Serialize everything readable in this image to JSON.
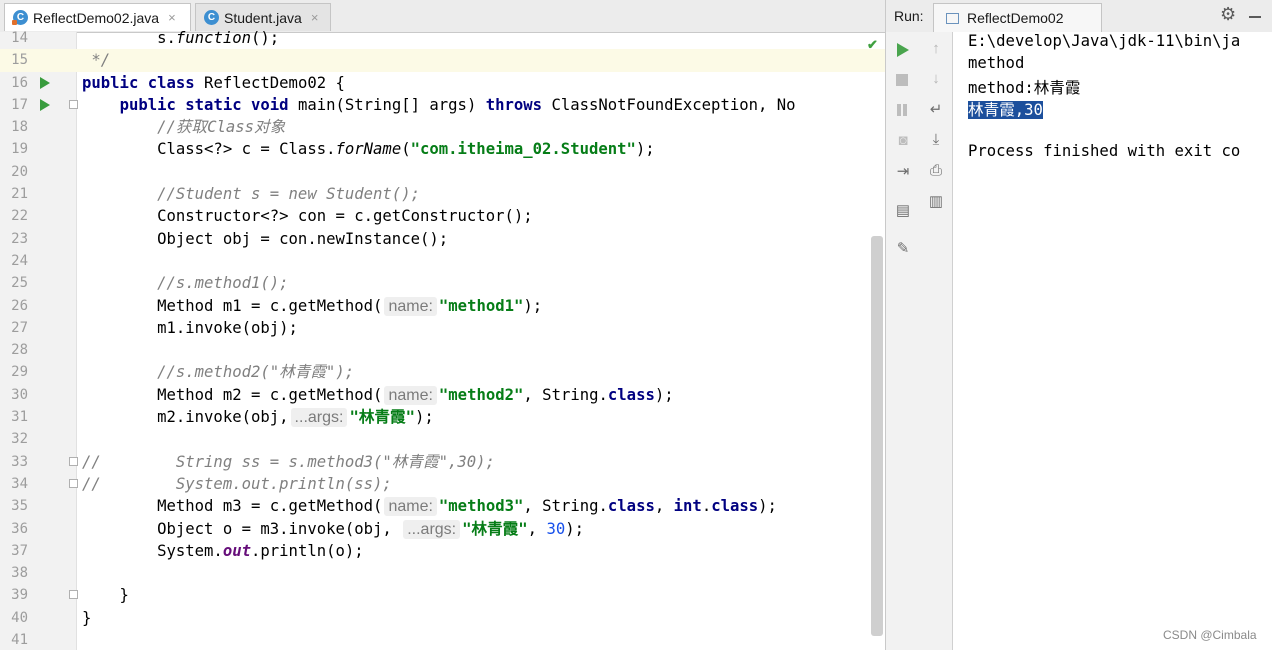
{
  "editor": {
    "tabs": [
      {
        "label": "ReflectDemo02.java",
        "close": "×"
      },
      {
        "label": "Student.java",
        "close": "×"
      }
    ],
    "file_icon_letter": "C",
    "lines": [
      {
        "n": "14",
        "code": "        s.function();"
      },
      {
        "n": "15",
        "code": " */"
      },
      {
        "n": "16",
        "code": "public class ReflectDemo02 {"
      },
      {
        "n": "17",
        "code": "    public static void main(String[] args) throws ClassNotFoundException, No"
      },
      {
        "n": "18",
        "code": "        //获取Class对象"
      },
      {
        "n": "19",
        "code": "        Class<?> c = Class.forName(\"com.itheima_02.Student\");"
      },
      {
        "n": "20",
        "code": ""
      },
      {
        "n": "21",
        "code": "        //Student s = new Student();"
      },
      {
        "n": "22",
        "code": "        Constructor<?> con = c.getConstructor();"
      },
      {
        "n": "23",
        "code": "        Object obj = con.newInstance();"
      },
      {
        "n": "24",
        "code": ""
      },
      {
        "n": "25",
        "code": "        //s.method1();"
      },
      {
        "n": "26",
        "code": "        Method m1 = c.getMethod( name: \"method1\");"
      },
      {
        "n": "27",
        "code": "        m1.invoke(obj);"
      },
      {
        "n": "28",
        "code": ""
      },
      {
        "n": "29",
        "code": "        //s.method2(\"林青霞\");"
      },
      {
        "n": "30",
        "code": "        Method m2 = c.getMethod( name: \"method2\", String.class);"
      },
      {
        "n": "31",
        "code": "        m2.invoke(obj, ...args: \"林青霞\");"
      },
      {
        "n": "32",
        "code": ""
      },
      {
        "n": "33",
        "code": "//        String ss = s.method3(\"林青霞\",30);"
      },
      {
        "n": "34",
        "code": "//        System.out.println(ss);"
      },
      {
        "n": "35",
        "code": "        Method m3 = c.getMethod( name: \"method3\", String.class, int.class);"
      },
      {
        "n": "36",
        "code": "        Object o = m3.invoke(obj,  ...args: \"林青霞\", 30);"
      },
      {
        "n": "37",
        "code": "        System.out.println(o);"
      },
      {
        "n": "38",
        "code": ""
      },
      {
        "n": "39",
        "code": "    }"
      },
      {
        "n": "40",
        "code": "}"
      },
      {
        "n": "41",
        "code": ""
      }
    ]
  },
  "run": {
    "label": "Run:",
    "tab_label": "ReflectDemo02",
    "console": [
      "E:\\develop\\Java\\jdk-11\\bin\\ja",
      "method",
      "method:林青霞",
      "林青霞,30",
      "",
      "Process finished with exit co"
    ]
  },
  "icons": {
    "tool_left": [
      "run-icon",
      "stop-icon",
      "pause-icon",
      "camera-icon",
      "exit-icon",
      "layout-icon",
      "pin-icon"
    ],
    "tool_right": [
      "up-arrow-icon",
      "down-arrow-icon",
      "soft-wrap-icon",
      "scroll-end-icon",
      "print-icon",
      "trash-icon"
    ]
  },
  "watermark": "CSDN @Cimbala"
}
